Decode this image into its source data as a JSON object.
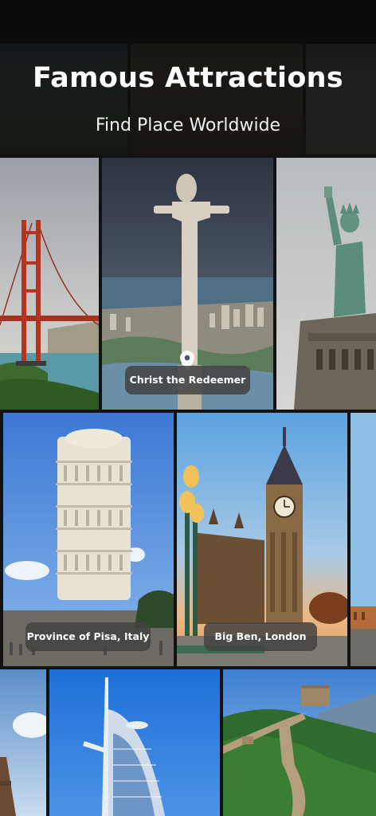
{
  "header": {
    "title": "Famous Attractions",
    "subtitle": "Find Place Worldwide"
  },
  "attractions": [
    {
      "id": "golden-gate",
      "label": "",
      "image": "golden-gate-bridge-photo"
    },
    {
      "id": "christ",
      "label": "Christ the Redeemer",
      "image": "christ-the-redeemer-photo",
      "pinned": true,
      "pin_icon": "location-pin-icon"
    },
    {
      "id": "liberty",
      "label": "",
      "image": "statue-of-liberty-photo"
    },
    {
      "id": "pisa",
      "label": "Province of Pisa, Italy",
      "image": "leaning-tower-of-pisa-photo"
    },
    {
      "id": "bigben",
      "label": "Big Ben,  London",
      "image": "big-ben-photo"
    },
    {
      "id": "eiffel",
      "label": "",
      "image": "eiffel-tower-photo"
    },
    {
      "id": "burj",
      "label": "",
      "image": "burj-al-arab-photo"
    },
    {
      "id": "wall",
      "label": "",
      "image": "great-wall-photo"
    }
  ],
  "colors": {
    "background": "#121212",
    "label_bg": "#424242",
    "label_text": "#ffffff",
    "title_text": "#ffffff"
  }
}
